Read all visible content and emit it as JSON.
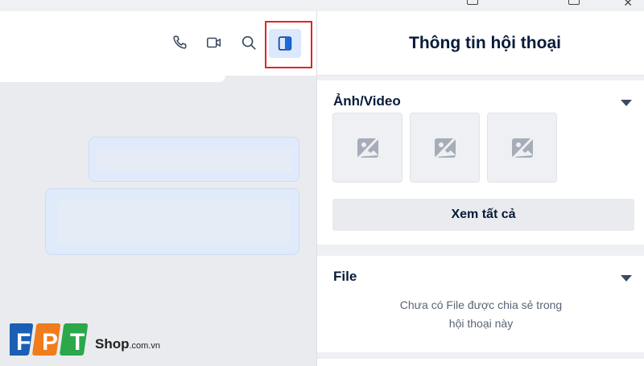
{
  "panel": {
    "title": "Thông tin hội thoại"
  },
  "media": {
    "title": "Ảnh/Video",
    "thumbnail_icon": "image-placeholder-icon",
    "thumbnail_count": 3,
    "see_all_label": "Xem tất cả"
  },
  "file": {
    "title": "File",
    "empty_line1": "Chưa có File được chia sẻ trong",
    "empty_line2": "hội thoại này"
  },
  "header_icons": [
    "phone-icon",
    "video-call-icon",
    "search-icon",
    "panel-toggle-icon"
  ],
  "watermark": {
    "brand": "FPT",
    "shop": "Shop",
    "domain": ".com.vn"
  },
  "colors": {
    "highlight": "#e0252a",
    "toggle_bg": "#dbe8fd",
    "toggle_icon": "#1a6bdc",
    "fpt_blue": "#1b5fb5",
    "fpt_orange": "#f07c1b",
    "fpt_green": "#2aa84a"
  }
}
